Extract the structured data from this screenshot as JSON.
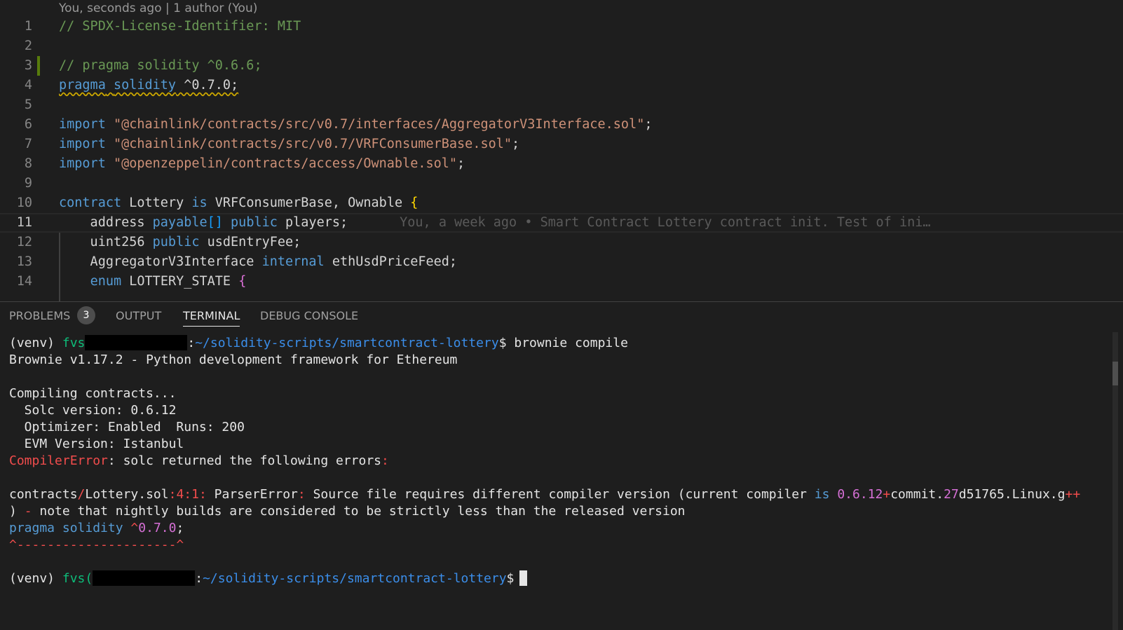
{
  "editor": {
    "blame_header": "You, seconds ago | 1 author (You)",
    "lines": [
      {
        "num": "1",
        "tokens": [
          {
            "t": "// SPDX-License-Identifier: MIT",
            "c": "c-com"
          }
        ]
      },
      {
        "num": "2",
        "tokens": []
      },
      {
        "num": "3",
        "tokens": [
          {
            "t": "// pragma solidity ^0.6.6;",
            "c": "c-com"
          }
        ]
      },
      {
        "num": "4",
        "tokens": [
          {
            "t": "pragma",
            "c": "c-kw squig"
          },
          {
            "t": " ",
            "c": "c-txt squig"
          },
          {
            "t": "solidity",
            "c": "c-kw squig"
          },
          {
            "t": " ^0.7.0;",
            "c": "c-txt squig"
          }
        ]
      },
      {
        "num": "5",
        "tokens": []
      },
      {
        "num": "6",
        "tokens": [
          {
            "t": "import ",
            "c": "c-kw"
          },
          {
            "t": "\"@chainlink/contracts/src/v0.7/interfaces/AggregatorV3Interface.sol\"",
            "c": "c-str"
          },
          {
            "t": ";",
            "c": "c-txt"
          }
        ]
      },
      {
        "num": "7",
        "tokens": [
          {
            "t": "import ",
            "c": "c-kw"
          },
          {
            "t": "\"@chainlink/contracts/src/v0.7/VRFConsumerBase.sol\"",
            "c": "c-str"
          },
          {
            "t": ";",
            "c": "c-txt"
          }
        ]
      },
      {
        "num": "8",
        "tokens": [
          {
            "t": "import ",
            "c": "c-kw"
          },
          {
            "t": "\"@openzeppelin/contracts/access/Ownable.sol\"",
            "c": "c-str"
          },
          {
            "t": ";",
            "c": "c-txt"
          }
        ]
      },
      {
        "num": "9",
        "tokens": []
      },
      {
        "num": "10",
        "tokens": [
          {
            "t": "contract ",
            "c": "c-kw"
          },
          {
            "t": "Lottery ",
            "c": "c-txt"
          },
          {
            "t": "is ",
            "c": "c-kw"
          },
          {
            "t": "VRFConsumerBase, Ownable ",
            "c": "c-txt"
          },
          {
            "t": "{",
            "c": "c-br1"
          }
        ]
      },
      {
        "num": "11",
        "tokens": [
          {
            "t": "    address ",
            "c": "c-txt"
          },
          {
            "t": "payable",
            "c": "c-kw"
          },
          {
            "t": "[]",
            "c": "c-br3"
          },
          {
            "t": " ",
            "c": "c-txt"
          },
          {
            "t": "public ",
            "c": "c-kw"
          },
          {
            "t": "players;",
            "c": "c-txt"
          }
        ],
        "blame": "You, a week ago • Smart Contract Lottery contract init. Test of ini…"
      },
      {
        "num": "12",
        "tokens": [
          {
            "t": "    uint256 ",
            "c": "c-txt"
          },
          {
            "t": "public ",
            "c": "c-kw"
          },
          {
            "t": "usdEntryFee;",
            "c": "c-txt"
          }
        ]
      },
      {
        "num": "13",
        "tokens": [
          {
            "t": "    AggregatorV3Interface ",
            "c": "c-txt"
          },
          {
            "t": "internal ",
            "c": "c-kw"
          },
          {
            "t": "ethUsdPriceFeed;",
            "c": "c-txt"
          }
        ]
      },
      {
        "num": "14",
        "tokens": [
          {
            "t": "    ",
            "c": "c-txt"
          },
          {
            "t": "enum ",
            "c": "c-kw"
          },
          {
            "t": "LOTTERY_STATE ",
            "c": "c-txt"
          },
          {
            "t": "{",
            "c": "c-br2"
          }
        ]
      }
    ]
  },
  "panel": {
    "tabs": {
      "problems": "PROBLEMS",
      "problems_count": "3",
      "output": "OUTPUT",
      "terminal": "TERMINAL",
      "debug_console": "DEBUG CONSOLE"
    }
  },
  "terminal": {
    "lines": [
      {
        "segs": [
          {
            "t": "(venv) "
          },
          {
            "t": "fvs",
            "c": "t-green"
          },
          {
            "redact": true
          },
          {
            "t": ":"
          },
          {
            "t": "~/solidity-scripts/smartcontract-lottery",
            "c": "t-blue"
          },
          {
            "t": "$ brownie compile"
          }
        ]
      },
      {
        "segs": [
          {
            "t": "Brownie v1.17.2 - Python development framework for Ethereum"
          }
        ]
      },
      {
        "segs": []
      },
      {
        "segs": [
          {
            "t": "Compiling contracts..."
          }
        ]
      },
      {
        "segs": [
          {
            "t": "  Solc version: 0.6.12"
          }
        ]
      },
      {
        "segs": [
          {
            "t": "  Optimizer: Enabled  Runs: 200"
          }
        ]
      },
      {
        "segs": [
          {
            "t": "  EVM Version: Istanbul"
          }
        ]
      },
      {
        "segs": [
          {
            "t": "CompilerError",
            "c": "t-red"
          },
          {
            "t": ": solc returned the following errors"
          },
          {
            "t": ":",
            "c": "t-red"
          }
        ]
      },
      {
        "segs": []
      },
      {
        "segs": [
          {
            "t": "contracts"
          },
          {
            "t": "/",
            "c": "t-red"
          },
          {
            "t": "Lottery.sol"
          },
          {
            "t": ":",
            "c": "t-red"
          },
          {
            "t": "4",
            "c": "t-red"
          },
          {
            "t": ":",
            "c": "t-red"
          },
          {
            "t": "1",
            "c": "t-red"
          },
          {
            "t": ": ",
            "c": "t-red"
          },
          {
            "t": "ParserError"
          },
          {
            "t": ":",
            "c": "t-red"
          },
          {
            "t": " Source file requires different compiler version (current compiler "
          },
          {
            "t": "is",
            "c": "t-blue2"
          },
          {
            "t": " "
          },
          {
            "t": "0.6.12",
            "c": "t-mag"
          },
          {
            "t": "+",
            "c": "t-red"
          },
          {
            "t": "commit."
          },
          {
            "t": "27",
            "c": "t-mag"
          },
          {
            "t": "d51765.Linux.g"
          },
          {
            "t": "++",
            "c": "t-red"
          }
        ]
      },
      {
        "segs": [
          {
            "t": ") "
          },
          {
            "t": "-",
            "c": "t-red"
          },
          {
            "t": " note that nightly builds are considered to be strictly less than the released version"
          }
        ]
      },
      {
        "segs": [
          {
            "t": "pragma",
            "c": "t-blue2"
          },
          {
            "t": " "
          },
          {
            "t": "solidity",
            "c": "t-blue2"
          },
          {
            "t": " "
          },
          {
            "t": "^",
            "c": "t-red"
          },
          {
            "t": "0.7.0",
            "c": "t-mag"
          },
          {
            "t": ";"
          }
        ]
      },
      {
        "segs": [
          {
            "t": "^---------------------^",
            "c": "t-red"
          }
        ]
      },
      {
        "segs": []
      },
      {
        "segs": [
          {
            "t": "(venv) "
          },
          {
            "t": "fvs(",
            "c": "t-green"
          },
          {
            "redact": true
          },
          {
            "t": ":"
          },
          {
            "t": "~/solidity-scripts/smartcontract-lottery",
            "c": "t-blue"
          },
          {
            "t": "$"
          },
          {
            "cursor": true
          }
        ]
      }
    ]
  }
}
